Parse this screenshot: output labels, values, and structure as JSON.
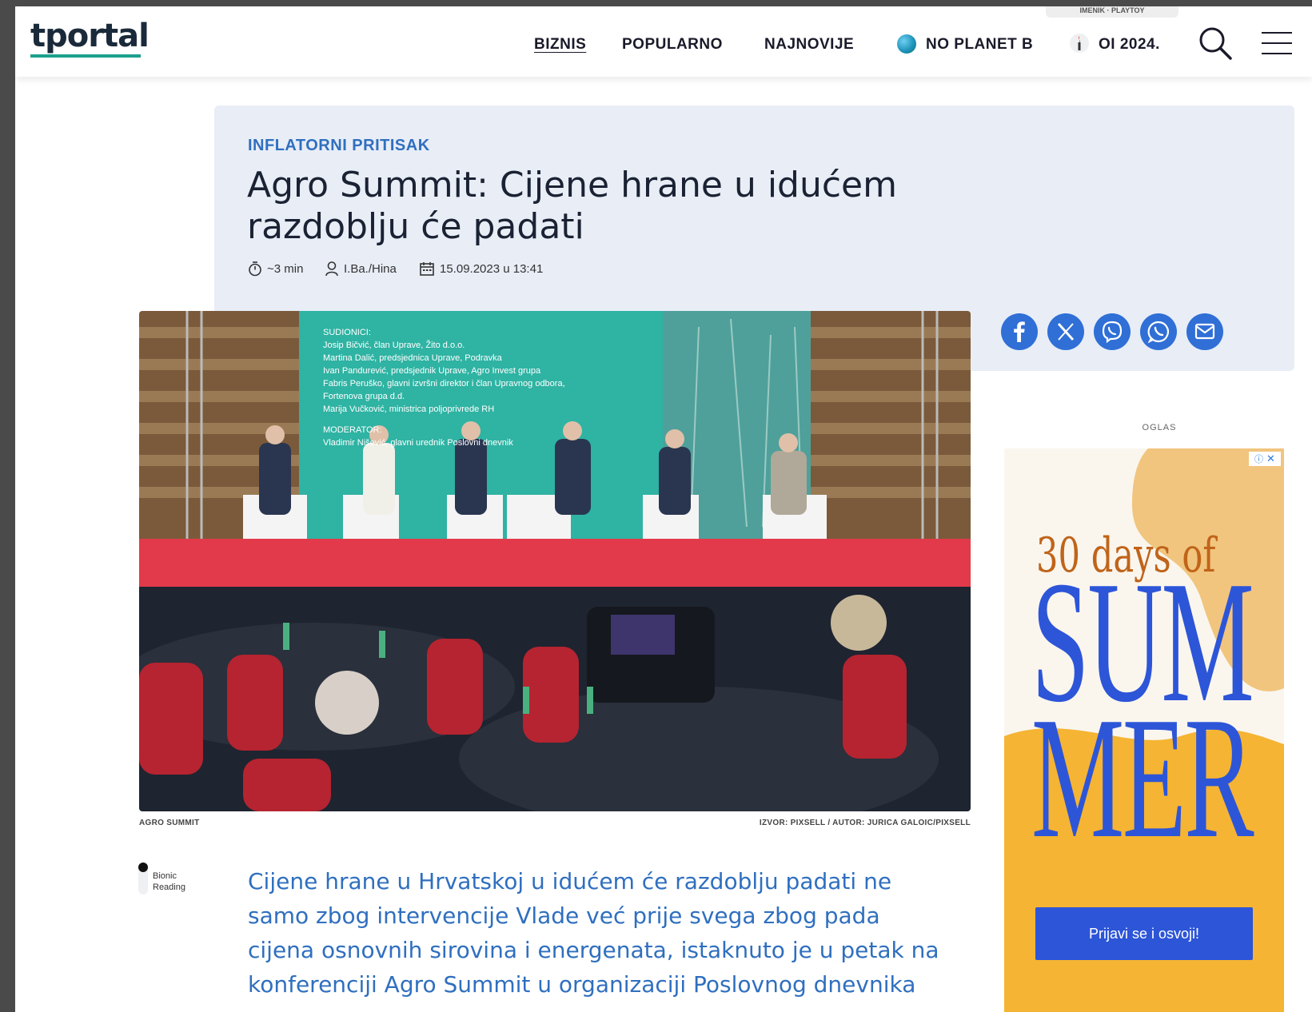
{
  "header": {
    "logo": "tportal",
    "top_links": "IMENIK · PLAYTOY",
    "nav": {
      "biznis": "BIZNIS",
      "popularno": "POPULARNO",
      "najnovije": "NAJNOVIJE",
      "no_planet_b": "NO PLANET B",
      "oi_2024": "OI 2024."
    },
    "icons": {
      "search": "search-icon",
      "menu": "hamburger-menu-icon"
    }
  },
  "article": {
    "kicker": "INFLATORNI PRITISAK",
    "headline": "Agro Summit: Cijene hrane u idućem razdoblju će padati",
    "meta": {
      "read_time": "~3 min",
      "author": "I.Ba./Hina",
      "date": "15.09.2023 u 13:41"
    },
    "photo": {
      "screen_lines": {
        "header": "SUDIONICI:",
        "p1": "Josip Bičvić, član Uprave, Žito d.o.o.",
        "p2": "Martina Dalić, predsjednica Uprave, Podravka",
        "p3": "Ivan Pandurević, predsjednik Uprave, Agro Invest grupa",
        "p4": "Fabris Peruško, glavni izvršni direktor i član Upravnog odbora,",
        "p4b": "Fortenova grupa d.d.",
        "p5": "Marija Vučković, ministrica poljoprivrede RH",
        "moderator_header": "MODERATOR:",
        "moderator": "Vladimir Nišević, glavni urednik Poslovni dnevnik"
      },
      "caption_left": "AGRO SUMMIT",
      "caption_right": "IZVOR: PIXSELL / AUTOR: JURICA GALOIC/PIXSELL"
    },
    "bionic": {
      "line1": "Bionic",
      "line2": "Reading"
    },
    "lead": "Cijene hrane u Hrvatskoj u idućem će razdoblju padati ne samo zbog intervencije Vlade već prije svega zbog pada cijena osnovnih sirovina i energenata, istaknuto je u petak na konferenciji Agro Summit u organizaciji Poslovnog dnevnika"
  },
  "share": {
    "icons": [
      "facebook-icon",
      "x-icon",
      "viber-icon",
      "whatsapp-icon",
      "email-icon"
    ]
  },
  "ad": {
    "label": "OGLAS",
    "line1": "30 days of",
    "line2": "SUM",
    "line3": "MER",
    "cta": "Prijavi se i osvoji!"
  },
  "colors": {
    "accent_blue": "#2f6fbf",
    "share_blue": "#2f6fd6",
    "hero_bg": "#e8edf6",
    "logo_teal": "#1aa08c"
  }
}
